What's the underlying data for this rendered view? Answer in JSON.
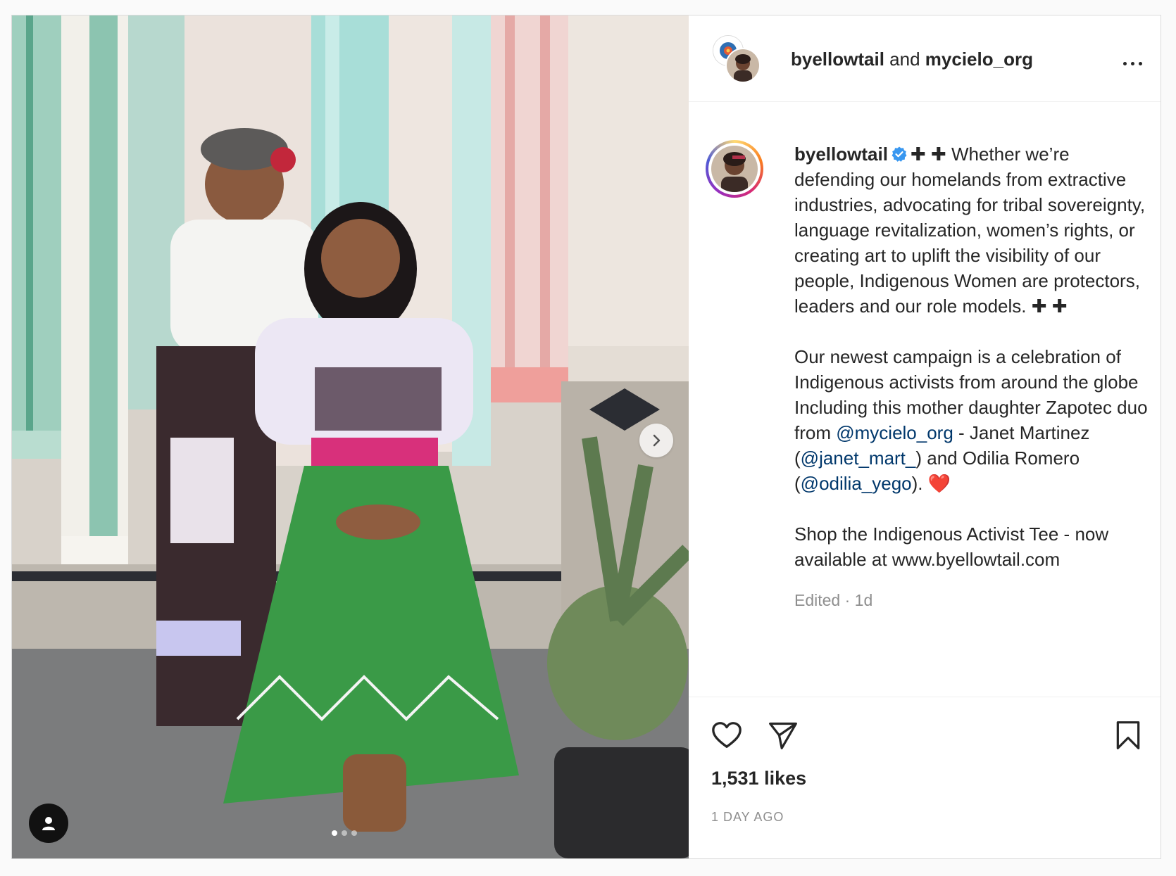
{
  "post": {
    "image": {
      "alt_icon": "user-tag-icon",
      "carousel": {
        "count": 3,
        "active_index": 0
      }
    },
    "header": {
      "author": "byellowtail",
      "connector": "and",
      "collaborator": "mycielo_org",
      "more_icon": "more-options-icon"
    },
    "caption": {
      "username": "byellowtail",
      "verified": true,
      "paragraph1": "✚ ✚ Whether we’re defending our homelands from extractive industries, advocating for tribal sovereignty, language revitalization, women’s rights, or creating art to uplift the visibility of our people, Indigenous Women are protectors, leaders and our role models. ✚ ✚",
      "separator1": "⠀⠀⠀⠀⠀⠀⠀⠀⠀⠀⠀⠀⠀⠀",
      "paragraph2_a": "Our newest campaign is a celebration of Indigenous activists from around the globe Including this mother daughter Zapotec duo from ",
      "mention1": "@mycielo_org",
      "paragraph2_b": " - Janet Martinez (",
      "mention2": "@janet_mart_",
      "paragraph2_c": ") and Odilia Romero (",
      "mention3": "@odilia_yego",
      "paragraph2_d": "). ❤️",
      "separator2": "⠀⠀⠀⠀⠀⠀⠀⠀⠀⠀⠀⠀⠀⠀",
      "paragraph3": "Shop the Indigenous Activist Tee - now available at www.byellowtail.com",
      "edited": "Edited · 1d"
    },
    "actions": {
      "like_icon": "heart-icon",
      "share_icon": "paper-plane-icon",
      "save_icon": "bookmark-icon",
      "likes": "1,531 likes",
      "timestamp": "1 DAY AGO"
    }
  },
  "colors": {
    "text": "#262626",
    "secondary": "#8e8e8e",
    "mention": "#00376b",
    "verified": "#3897f0",
    "border": "#dbdbdb"
  }
}
